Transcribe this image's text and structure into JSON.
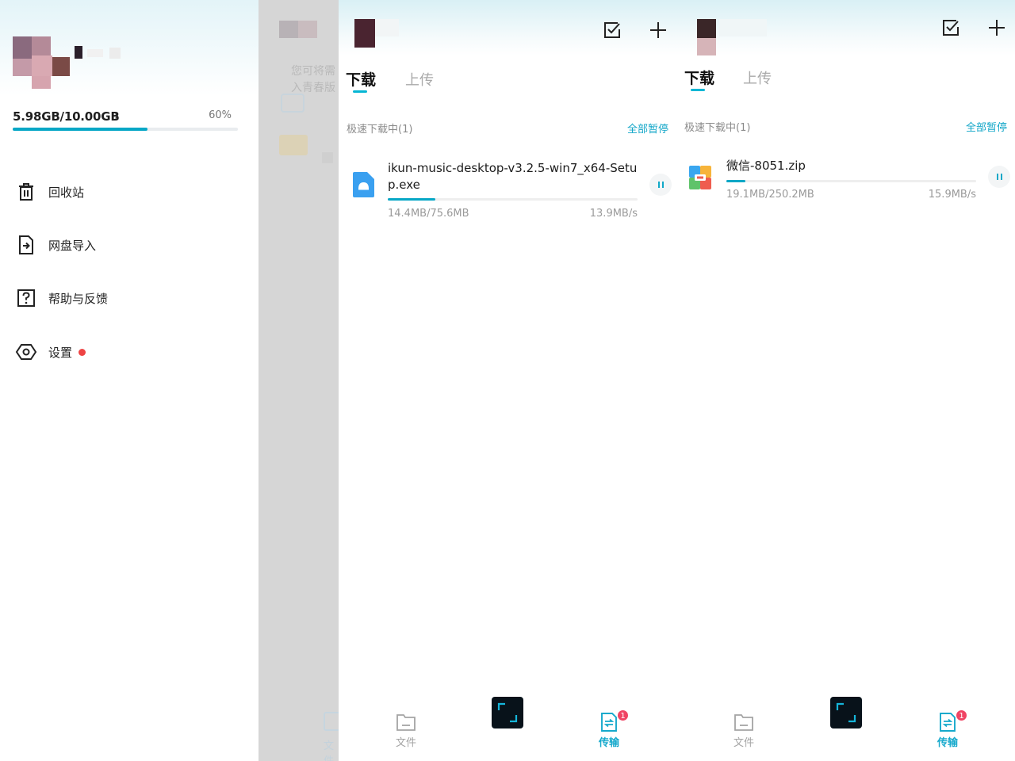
{
  "drawer": {
    "storage": {
      "used_total": "5.98GB/10.00GB",
      "chevron": "›",
      "percent_label": "60%",
      "percent_value": 0.598
    },
    "menu": [
      {
        "label": "回收站",
        "icon": "trash-icon"
      },
      {
        "label": "网盘导入",
        "icon": "import-file-icon"
      },
      {
        "label": "帮助与反馈",
        "icon": "help-icon"
      },
      {
        "label": "设置",
        "icon": "settings-icon",
        "has_red_dot": true
      }
    ]
  },
  "background_panel": {
    "ghost_text_line1": "您可将需",
    "ghost_text_line2": "入青春版",
    "ghost_nav_label": "文件"
  },
  "panels": [
    {
      "tabs": {
        "download": "下载",
        "upload": "上传"
      },
      "section_label": "极速下载中(1)",
      "pause_all": "全部暂停",
      "item": {
        "file_name": "ikun-music-desktop-v3.2.5-win7_x64-Setup.exe",
        "file_icon": "installer-file-icon",
        "size_progress": "14.4MB/75.6MB",
        "speed": "13.9MB/s",
        "progress": 0.19
      },
      "nav": {
        "files": "文件",
        "transfer": "传输",
        "badge": "1"
      }
    },
    {
      "tabs": {
        "download": "下载",
        "upload": "上传"
      },
      "section_label": "极速下载中(1)",
      "pause_all": "全部暂停",
      "item": {
        "file_name": "微信-8051.zip",
        "file_icon": "zip-archive-icon",
        "size_progress": "19.1MB/250.2MB",
        "speed": "15.9MB/s",
        "progress": 0.076
      },
      "nav": {
        "files": "文件",
        "transfer": "传输",
        "badge": "1"
      }
    }
  ],
  "colors": {
    "accent": "#06a7c6",
    "badge": "#f04464",
    "red_dot": "#ee4444"
  }
}
